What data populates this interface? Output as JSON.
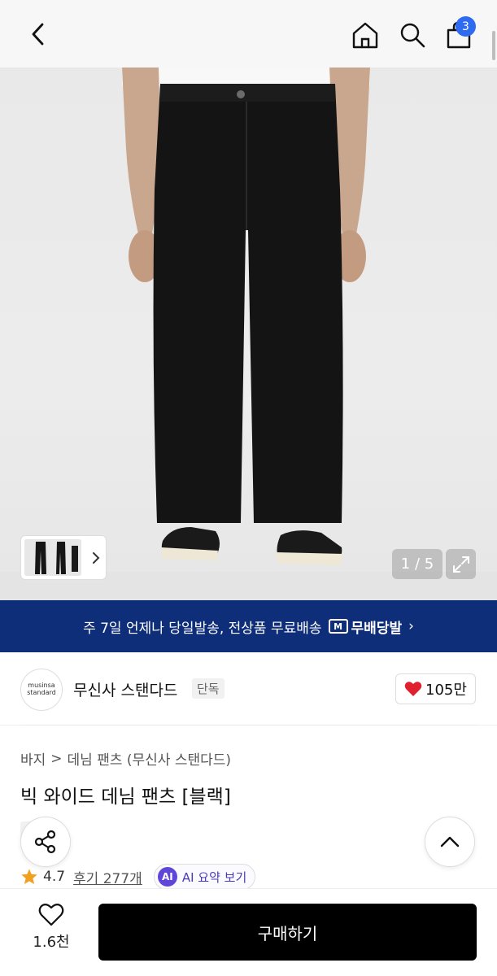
{
  "header": {
    "cart_count": "3"
  },
  "gallery": {
    "counter": "1 / 5"
  },
  "banner": {
    "text": "주 7일 언제나 당일발송, 전상품 무료배송",
    "badge_mark": "M",
    "badge_text": "무배당발",
    "chevron": "›"
  },
  "brand": {
    "logo_line1": "musinsa",
    "logo_line2": "standard",
    "name": "무신사 스탠다드",
    "tag": "단독",
    "likes": "105만"
  },
  "breadcrumb": {
    "first": "바지",
    "separator": ">",
    "second": "데님 팬츠 (무신사 스탠다드)"
  },
  "product": {
    "title": "빅 와이드 데님 팬츠 [블랙]",
    "tag": "단독",
    "rating": "4.7",
    "reviews": "후기 277개",
    "ai_badge": "AI",
    "ai_label": "AI 요약 보기"
  },
  "bottom_bar": {
    "wish_count": "1.6천",
    "buy_label": "구매하기"
  },
  "colors": {
    "banner_bg": "#0f2e7a",
    "badge_blue": "#2e6bf0",
    "heart_red": "#e0202f",
    "star": "#f2a01f",
    "ai_purple": "#5f45d9"
  }
}
